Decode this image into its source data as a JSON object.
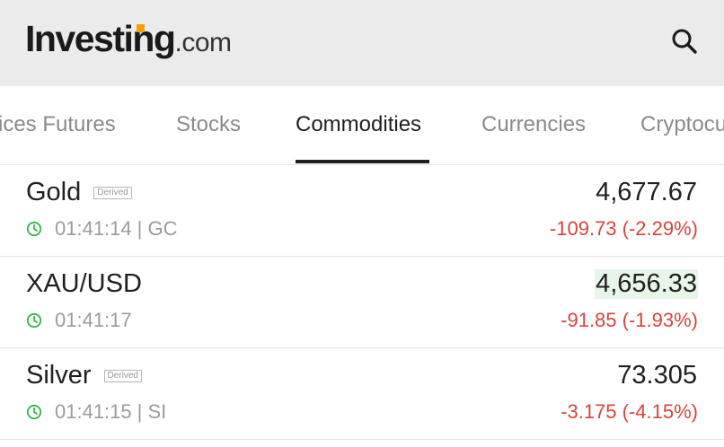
{
  "header": {
    "logo_main": "Investing",
    "logo_domain": ".com",
    "search_icon": "search-icon",
    "logo_accent_color": "#f5a000"
  },
  "tabs": [
    {
      "label": "ices Futures",
      "active": false
    },
    {
      "label": "Stocks",
      "active": false
    },
    {
      "label": "Commodities",
      "active": true
    },
    {
      "label": "Currencies",
      "active": false
    },
    {
      "label": "Cryptocu",
      "active": false
    }
  ],
  "instruments": [
    {
      "name": "Gold",
      "badge": "Derived",
      "time": "01:41:14",
      "symbol": "| GC",
      "price": "4,677.67",
      "change": "-109.73 (-2.29%)",
      "price_flash": false
    },
    {
      "name": "XAU/USD",
      "badge": "",
      "time": "01:41:17",
      "symbol": "",
      "price": "4,656.33",
      "change": "-91.85 (-1.93%)",
      "price_flash": true
    },
    {
      "name": "Silver",
      "badge": "Derived",
      "time": "01:41:15",
      "symbol": "| SI",
      "price": "73.305",
      "change": "-3.175 (-4.15%)",
      "price_flash": false
    }
  ],
  "colors": {
    "negative": "#d9443c",
    "clock_green": "#34b54a",
    "flash_bg": "#e8f6e9"
  }
}
